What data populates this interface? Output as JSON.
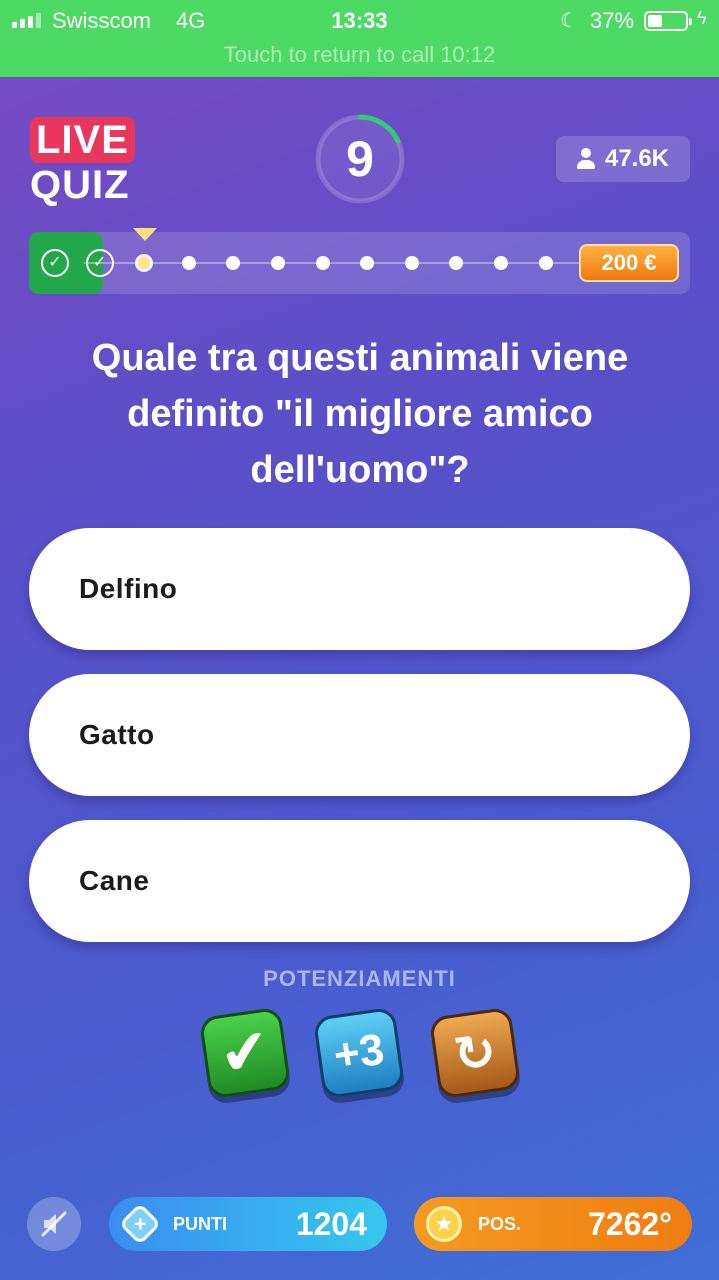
{
  "status_bar": {
    "carrier": "Swisscom",
    "network": "4G",
    "time": "13:33",
    "battery": "37%",
    "call_banner": "Touch to return to call 10:12"
  },
  "header": {
    "logo_live": "LIVE",
    "logo_quiz": "QUIZ",
    "timer": "9",
    "timer_remaining_fraction": 0.18,
    "viewers": "47.6K"
  },
  "progress": {
    "completed_steps": 2,
    "total_steps": 12,
    "current_step": 3,
    "prize": "200 €"
  },
  "question": "Quale tra questi animali viene definito \"il migliore amico dell'uomo\"?",
  "answers": [
    {
      "label": "Delfino"
    },
    {
      "label": "Gatto"
    },
    {
      "label": "Cane"
    }
  ],
  "powerups": {
    "title": "POTENZIAMENTI",
    "items": [
      {
        "icon": "check-powerup-icon",
        "glyph": "✔"
      },
      {
        "icon": "plus3-powerup-icon",
        "glyph": "+3"
      },
      {
        "icon": "swap-powerup-icon",
        "glyph": "↻"
      }
    ]
  },
  "bottom": {
    "points_label": "PUNTI",
    "points_value": "1204",
    "position_label": "POS.",
    "position_value": "7262°"
  },
  "colors": {
    "status_green": "#4cd964",
    "accent_live": "#e8365c",
    "progress_done": "#22a84a",
    "prize_orange": "#f07a12",
    "timer_arc": "#2ecc71"
  }
}
